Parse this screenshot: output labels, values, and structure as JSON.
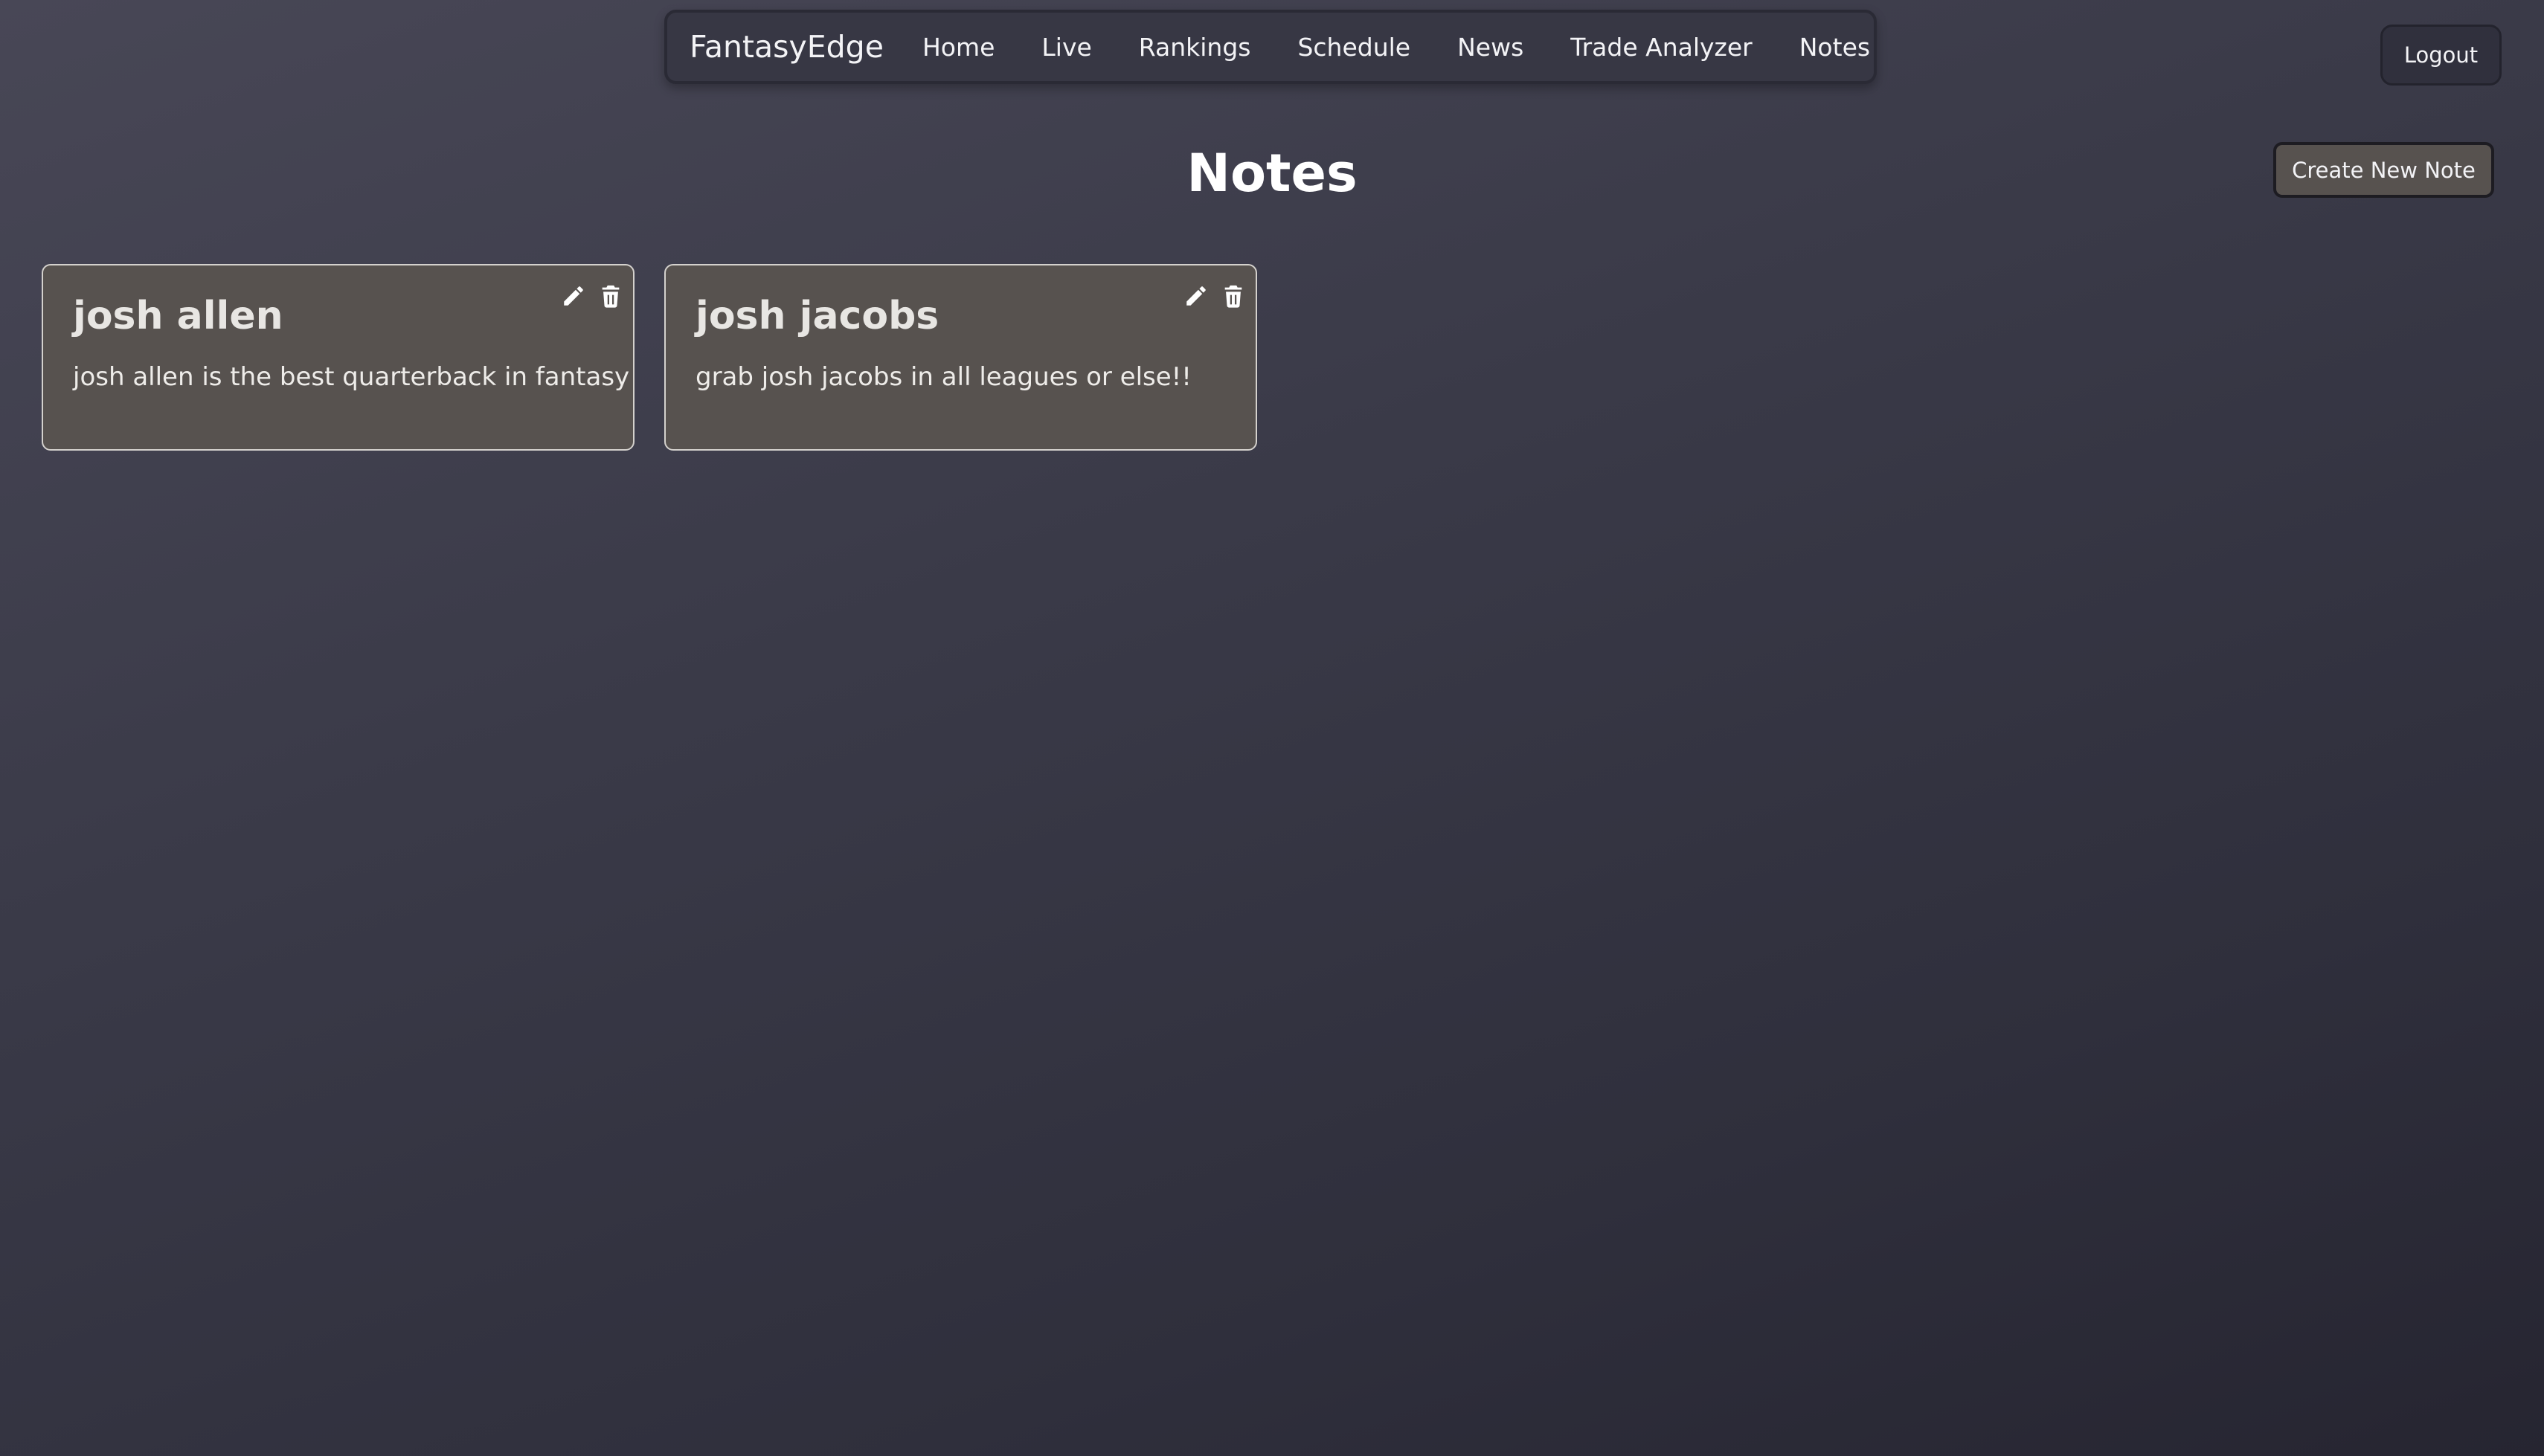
{
  "nav": {
    "brand": "FantasyEdge",
    "items": [
      {
        "label": "Home"
      },
      {
        "label": "Live"
      },
      {
        "label": "Rankings"
      },
      {
        "label": "Schedule"
      },
      {
        "label": "News"
      },
      {
        "label": "Trade Analyzer"
      },
      {
        "label": "Notes"
      }
    ]
  },
  "header": {
    "logout_label": "Logout",
    "page_title": "Notes",
    "create_label": "Create New Note"
  },
  "notes": [
    {
      "title": "josh allen",
      "body": "josh allen is the best quarterback in fantasy",
      "edit_icon": "pencil-icon",
      "delete_icon": "trash-icon"
    },
    {
      "title": "josh jacobs",
      "body": "grab josh jacobs in all leagues or else!!",
      "edit_icon": "pencil-icon",
      "delete_icon": "trash-icon"
    }
  ],
  "colors": {
    "background_top": "#484756",
    "background_bottom": "#262531",
    "card": "#57524f",
    "navbar": "#373744"
  }
}
